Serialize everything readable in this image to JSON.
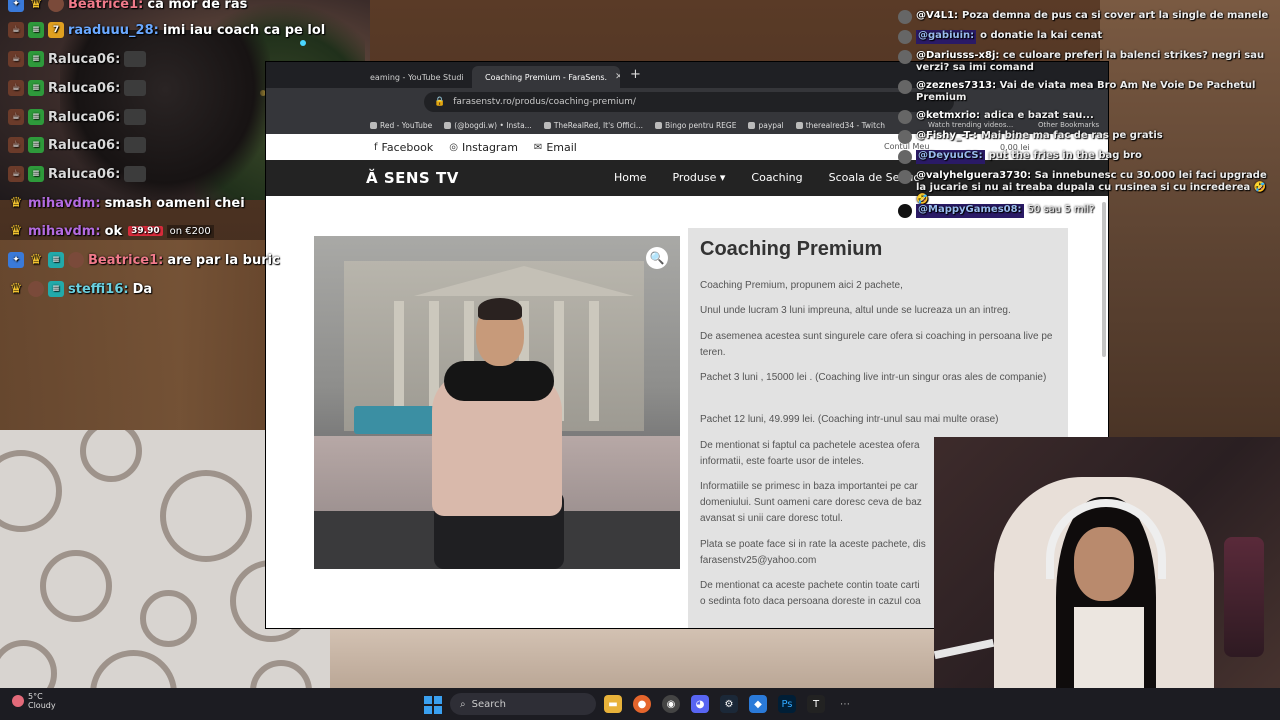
{
  "stream_chat_left": [
    {
      "user": "Beatrice1:",
      "user_color": "#f07a8a",
      "text": "ca mor de ras",
      "badges": [
        "prime-icon",
        "crown-icon",
        "emote-badge-icon"
      ]
    },
    {
      "user": "raaduuu_28:",
      "user_color": "#6aa8ff",
      "text": "imi iau coach ca pe lol",
      "badges": [
        "cup-icon",
        "sub-badge-icon",
        "sub-tier-icon"
      ]
    },
    {
      "user": "Raluca06:",
      "user_color": "#d9d9d9",
      "text": "",
      "badges": [
        "cup-icon",
        "sub-badge-icon"
      ]
    },
    {
      "user": "Raluca06:",
      "user_color": "#d9d9d9",
      "text": "",
      "badges": [
        "cup-icon",
        "sub-badge-icon"
      ]
    },
    {
      "user": "Raluca06:",
      "user_color": "#d9d9d9",
      "text": "",
      "badges": [
        "cup-icon",
        "sub-badge-icon"
      ]
    },
    {
      "user": "Raluca06:",
      "user_color": "#d9d9d9",
      "text": "",
      "badges": [
        "cup-icon",
        "sub-badge-icon"
      ]
    },
    {
      "user": "Raluca06:",
      "user_color": "#d9d9d9",
      "text": "",
      "badges": [
        "cup-icon",
        "sub-badge-icon"
      ]
    },
    {
      "user": "mihavdm:",
      "user_color": "#b46be0",
      "text": "smash oameni chei",
      "badges": [
        "crown-icon"
      ]
    },
    {
      "user": "mihavdm:",
      "user_color": "#b46be0",
      "text": "ok",
      "badges": [
        "crown-icon"
      ],
      "pill": "39.90",
      "amount": "on €200"
    },
    {
      "user": "Beatrice1:",
      "user_color": "#f07a8a",
      "text": "are par la buric",
      "badges": [
        "prime-icon",
        "crown-icon",
        "sub-badge-icon",
        "emote-badge-icon"
      ]
    },
    {
      "user": "steffi16:",
      "user_color": "#6ad0e0",
      "text": "Da",
      "badges": [
        "crown-icon",
        "emote-badge-icon",
        "sub-badge-icon"
      ]
    }
  ],
  "stream_chat_right": [
    {
      "user": "@V4L1:",
      "text": "Poza demna de pus ca si cover art la single de manele"
    },
    {
      "user": "@gabiuin:",
      "text": "o donatie la kai cenat",
      "highlight": true
    },
    {
      "user": "@Dariusss-x8j:",
      "text": "ce culoare preferi la balenci strikes? negri sau verzi? sa imi comand"
    },
    {
      "user": "@zeznes7313:",
      "text": "Vai de viata mea Bro Am Ne Voie De Pachetul Premium"
    },
    {
      "user": "@ketmxrio:",
      "text": "adica e bazat sau..."
    },
    {
      "user": "@Fishy_-T-:",
      "text": "Mai bine ma fac de ras pe gratis"
    },
    {
      "user": "@DeyuuCS:",
      "text": "put the fries in the bag bro",
      "highlight": true
    },
    {
      "user": "@valyhelguera3730:",
      "text": "Sa innebunesc cu 30.000 lei faci upgrade la jucarie si nu ai treaba dupala cu rusinea si cu increderea 🤣🤣"
    },
    {
      "user": "@MappyGames08:",
      "text": "50 sau 5 mil?",
      "highlight": true
    }
  ],
  "browser": {
    "tabs": [
      {
        "label": "eaming - YouTube Studi",
        "active": false
      },
      {
        "label": "Coaching Premium - FaraSens.",
        "active": true
      }
    ],
    "url": "farasenstv.ro/produs/coaching-premium/",
    "bookmarks": [
      "Red - YouTube",
      "(@bogdi.w) • Insta...",
      "TheRealRed, It's Offici...",
      "Bingo pentru REGE",
      "paypal",
      "therealred34 - Twitch"
    ],
    "bookmarks_overlay": [
      "Watch trending videos...",
      "Other Bookmarks"
    ],
    "account": "Contul Meu",
    "cart": "0,00 lei",
    "top_links": [
      {
        "icon": "facebook-icon",
        "label": "Facebook"
      },
      {
        "icon": "instagram-icon",
        "label": "Instagram"
      },
      {
        "icon": "email-icon",
        "label": "Email"
      }
    ],
    "logo": "Ă SENS TV",
    "nav": [
      "Home",
      "Produse ▾",
      "Coaching",
      "Scoala de Seduc"
    ],
    "product_title": "Coaching Premium",
    "description": [
      "Coaching Premium, propunem aici 2 pachete,",
      "Unul unde lucram 3 luni impreuna, altul unde se lucreaza un an intreg.",
      "De asemenea acestea sunt singurele care ofera si coaching in persoana live pe teren.",
      "Pachet 3 luni , 15000 lei .  (Coaching live intr-un singur oras ales de companie)",
      "Pachet 12 luni, 49.999 lei. (Coaching intr-unul sau mai multe orase)",
      "De mentionat si faptul ca pachetele acestea ofera",
      "informatii, este foarte usor de inteles.",
      "Informatiile se primesc in baza importantei pe car",
      "domeniului. Sunt oameni care doresc ceva de baz",
      "avansat si unii care doresc totul.",
      "Plata se poate face si in rate la aceste pachete, dis",
      "farasenstv25@yahoo.com",
      "De mentionat ca aceste pachete contin toate carti",
      "o sedinta foto daca persoana doreste in cazul coa"
    ]
  },
  "taskbar": {
    "weather_temp": "5°C",
    "weather_desc": "Cloudy",
    "search_label": "Search"
  }
}
